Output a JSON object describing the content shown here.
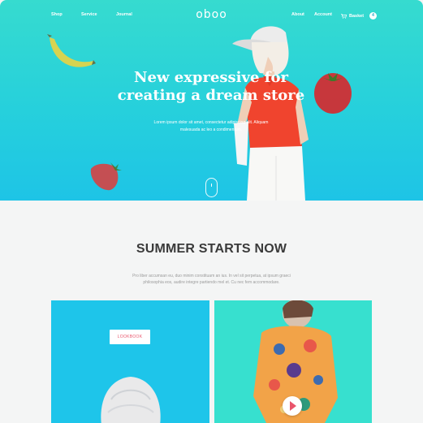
{
  "nav": {
    "left": [
      "Shop",
      "Service",
      "Journal"
    ],
    "right": [
      "About",
      "Account"
    ],
    "basket_label": "Basket",
    "basket_count": "4",
    "logo": "oboo"
  },
  "hero": {
    "headline_line1": "New expressive for",
    "headline_line2": "creating a dream store",
    "subtext_line1": "Lorem ipsum dolor sit amet, consectetur adipiscing elit. Aliquam",
    "subtext_line2": "malesuada ac leo a condimentum."
  },
  "section": {
    "title": "SUMMER STARTS NOW",
    "desc_line1": "Pro liber accumsan eu, duo minim constituam an ius. In vel sit perpetua, at ipsum graeci",
    "desc_line2": "philosophia eos, audire integre partiendo mel et. Cu nec fem accommodare."
  },
  "cards": {
    "lookbook_label": "LOOKBOOK"
  },
  "colors": {
    "hero_top": "#36dbcf",
    "hero_bottom": "#1ec4e6",
    "accent": "#e9546b",
    "card_left": "#1ec5ea",
    "card_right": "#37e0cf"
  }
}
